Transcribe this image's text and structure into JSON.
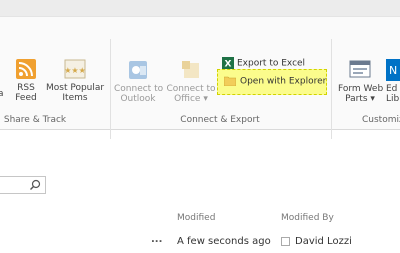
{
  "ribbon": {
    "buttons": {
      "partial": "a",
      "rss_line1": "RSS",
      "rss_line2": "Feed",
      "popular_line1": "Most Popular",
      "popular_line2": "Items",
      "outlook_line1": "Connect to",
      "outlook_line2": "Outlook",
      "office_line1": "Connect to",
      "office_line2": "Office",
      "excel": "Export to Excel",
      "explorer": "Open with Explorer",
      "formweb_line1": "Form Web",
      "formweb_line2": "Parts",
      "edit_line1": "Ed",
      "edit_line2": "Lib"
    },
    "groups": {
      "share": "Share & Track",
      "connect": "Connect & Export",
      "customize": "Customiz"
    }
  },
  "search": {
    "placeholder": ""
  },
  "table": {
    "headers": {
      "modified": "Modified",
      "modified_by": "Modified By"
    },
    "row": {
      "menu": "...",
      "modified": "A few seconds ago",
      "modified_by": "David Lozzi"
    }
  },
  "colors": {
    "highlight": "#fbfc8c",
    "accent": "#0072c6"
  }
}
